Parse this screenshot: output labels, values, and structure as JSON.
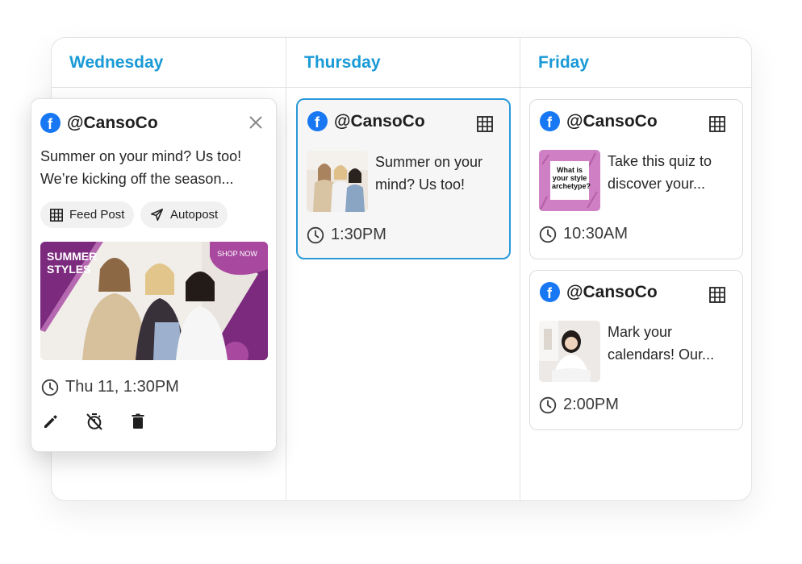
{
  "columns": [
    {
      "day": "Wednesday"
    },
    {
      "day": "Thursday"
    },
    {
      "day": "Friday"
    }
  ],
  "popup": {
    "handle": "@CansoCo",
    "text": "Summer on your mind? Us too! We’re kicking off the season...",
    "chips": [
      "Feed Post",
      "Autopost"
    ],
    "banner_left": "SUMMER STYLES",
    "banner_right": "SHOP NOW",
    "time": "Thu 11, 1:30PM"
  },
  "cards": [
    {
      "handle": "@CansoCo",
      "text": "Summer on your mind? Us too!",
      "time": "1:30PM"
    },
    {
      "handle": "@CansoCo",
      "text": "Take this quiz to discover your...",
      "time": "10:30AM",
      "thumb_text": "What is your style archetype?"
    },
    {
      "handle": "@CansoCo",
      "text": "Mark your calendars! Our...",
      "time": "2:00PM"
    }
  ],
  "colors": {
    "accent": "#1a9ad6",
    "facebook": "#1877f2",
    "purple": "#7b2a7e",
    "selected_border": "#2a9ad8"
  },
  "icons": [
    "facebook-icon",
    "grid-icon",
    "close-icon",
    "clock-icon",
    "send-icon",
    "edit-icon",
    "timer-off-icon",
    "trash-icon"
  ]
}
